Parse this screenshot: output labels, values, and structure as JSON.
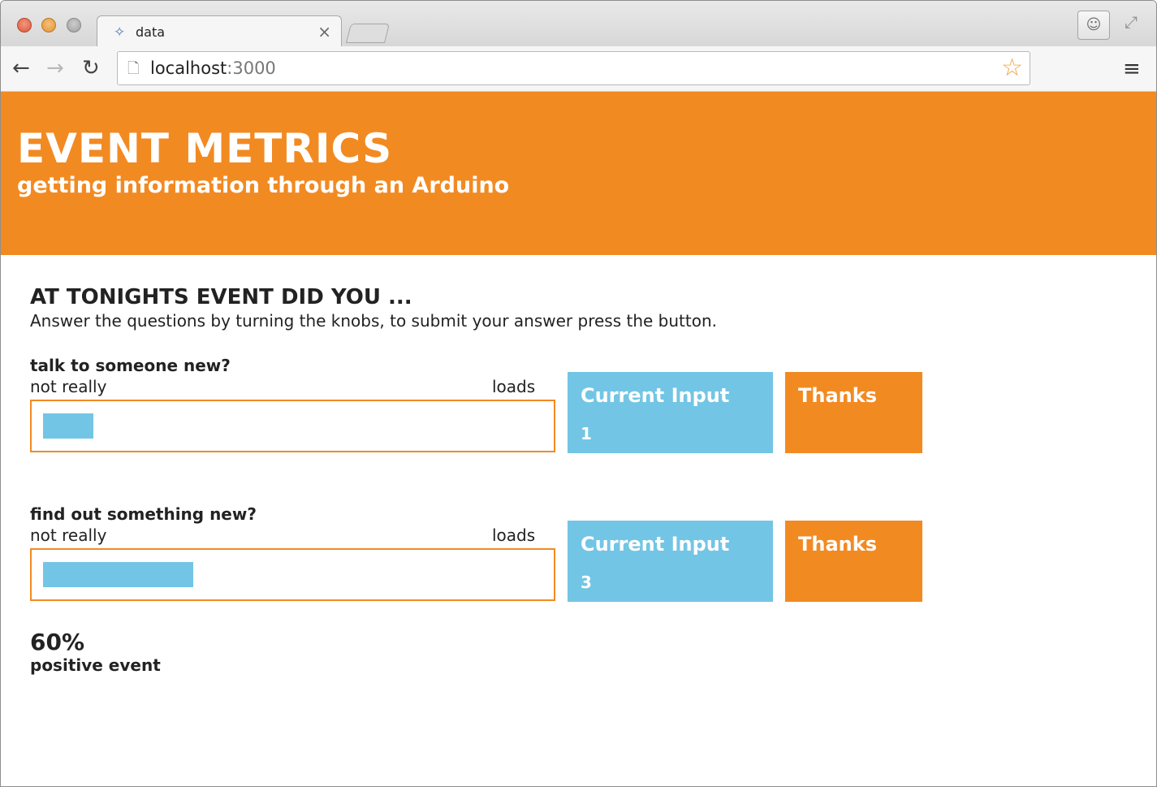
{
  "browser": {
    "tab_title": "data",
    "tab_close": "×",
    "url_host": "localhost",
    "url_port": ":3000",
    "icons": {
      "favicon": "code-diamond-icon",
      "back": "arrow-left-icon",
      "forward": "arrow-right-icon",
      "reload": "reload-icon",
      "page": "page-icon",
      "bookmark": "star-icon",
      "menu": "hamburger-menu-icon",
      "profile": "user-icon",
      "fullscreen": "expand-icon"
    }
  },
  "header": {
    "title": "EVENT METRICS",
    "subtitle": "getting information through an Arduino"
  },
  "survey": {
    "heading": "AT TONIGHTS EVENT DID YOU ...",
    "instructions": "Answer the questions by turning the knobs, to submit your answer press the button.",
    "questions": [
      {
        "label": "talk to someone new?",
        "scale_min": "not really",
        "scale_max": "loads",
        "fill_fraction": 0.1,
        "card_title": "Current Input",
        "current_input": "1",
        "thanks": "Thanks"
      },
      {
        "label": "find out something new?",
        "scale_min": "not really",
        "scale_max": "loads",
        "fill_fraction": 0.3,
        "card_title": "Current Input",
        "current_input": "3",
        "thanks": "Thanks"
      }
    ]
  },
  "result": {
    "value": "60%",
    "label": "positive event"
  },
  "colors": {
    "brand_orange": "#f28a22",
    "accent_blue": "#73c5e5",
    "text": "#222222"
  }
}
